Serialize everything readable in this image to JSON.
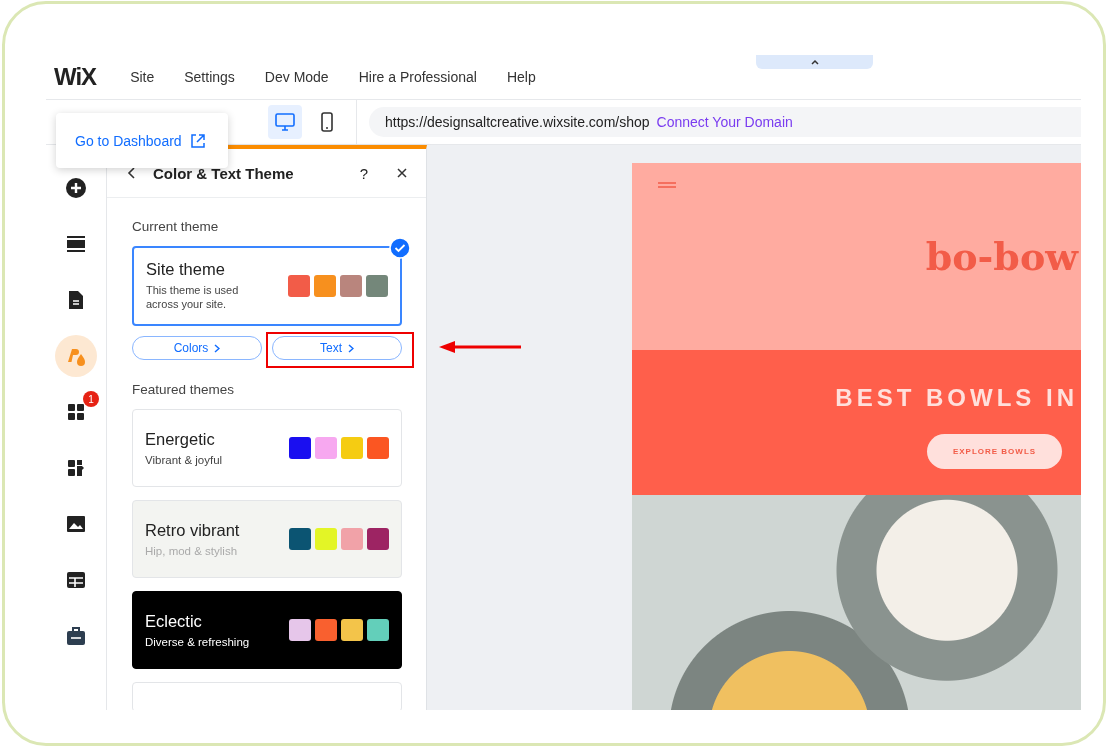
{
  "logo": "WiX",
  "menu": [
    "Site",
    "Settings",
    "Dev Mode",
    "Hire a Professional",
    "Help"
  ],
  "toolbar": {
    "devices": [
      {
        "selected": true
      },
      {
        "selected": false
      }
    ],
    "url": "https://designsaltcreative.wixsite.com/shop",
    "domain_link": "Connect Your Domain"
  },
  "popover": {
    "label": "Go to Dashboard"
  },
  "sidebar": {
    "items": [
      {
        "selected": false
      },
      {
        "selected": false
      },
      {
        "selected": false
      },
      {
        "selected": true
      },
      {
        "selected": false,
        "badge": "1"
      },
      {
        "selected": false
      },
      {
        "selected": false
      },
      {
        "selected": false
      },
      {
        "selected": false
      }
    ]
  },
  "panel": {
    "title": "Color & Text Theme",
    "help": "?",
    "current_heading": "Current theme",
    "current": {
      "name": "Site theme",
      "description": "This theme is used across your site.",
      "selected": true,
      "swatches": [
        {
          "color": "#f25c48"
        },
        {
          "color": "#f7901e"
        },
        {
          "color": "#b9857d"
        },
        {
          "color": "#74877a"
        }
      ]
    },
    "buttons": [
      "Colors",
      "Text"
    ],
    "featured_heading": "Featured themes",
    "themes": [
      {
        "kind": "light",
        "name": "Energetic",
        "description": "Vibrant & joyful",
        "swatches": [
          {
            "color": "#1a0ff0"
          },
          {
            "color": "#f7a8f0"
          },
          {
            "color": "#f5cc12"
          },
          {
            "color": "#fb5622"
          }
        ]
      },
      {
        "kind": "muted",
        "name": "Retro vibrant",
        "description": "Hip, mod & stylish",
        "swatches": [
          {
            "color": "#0b5472"
          },
          {
            "color": "#e3f526"
          },
          {
            "color": "#f1a2a8"
          },
          {
            "color": "#9d2463"
          }
        ]
      },
      {
        "kind": "dark",
        "name": "Eclectic",
        "description": "Diverse & refreshing",
        "swatches": [
          {
            "color": "#e6c6ea"
          },
          {
            "color": "#f9602f"
          },
          {
            "color": "#f3c44a"
          },
          {
            "color": "#63cfba"
          }
        ]
      }
    ]
  },
  "site": {
    "logo": "bo-bow",
    "headline": "BEST BOWLS IN",
    "button": "EXPLORE BOWLS"
  }
}
